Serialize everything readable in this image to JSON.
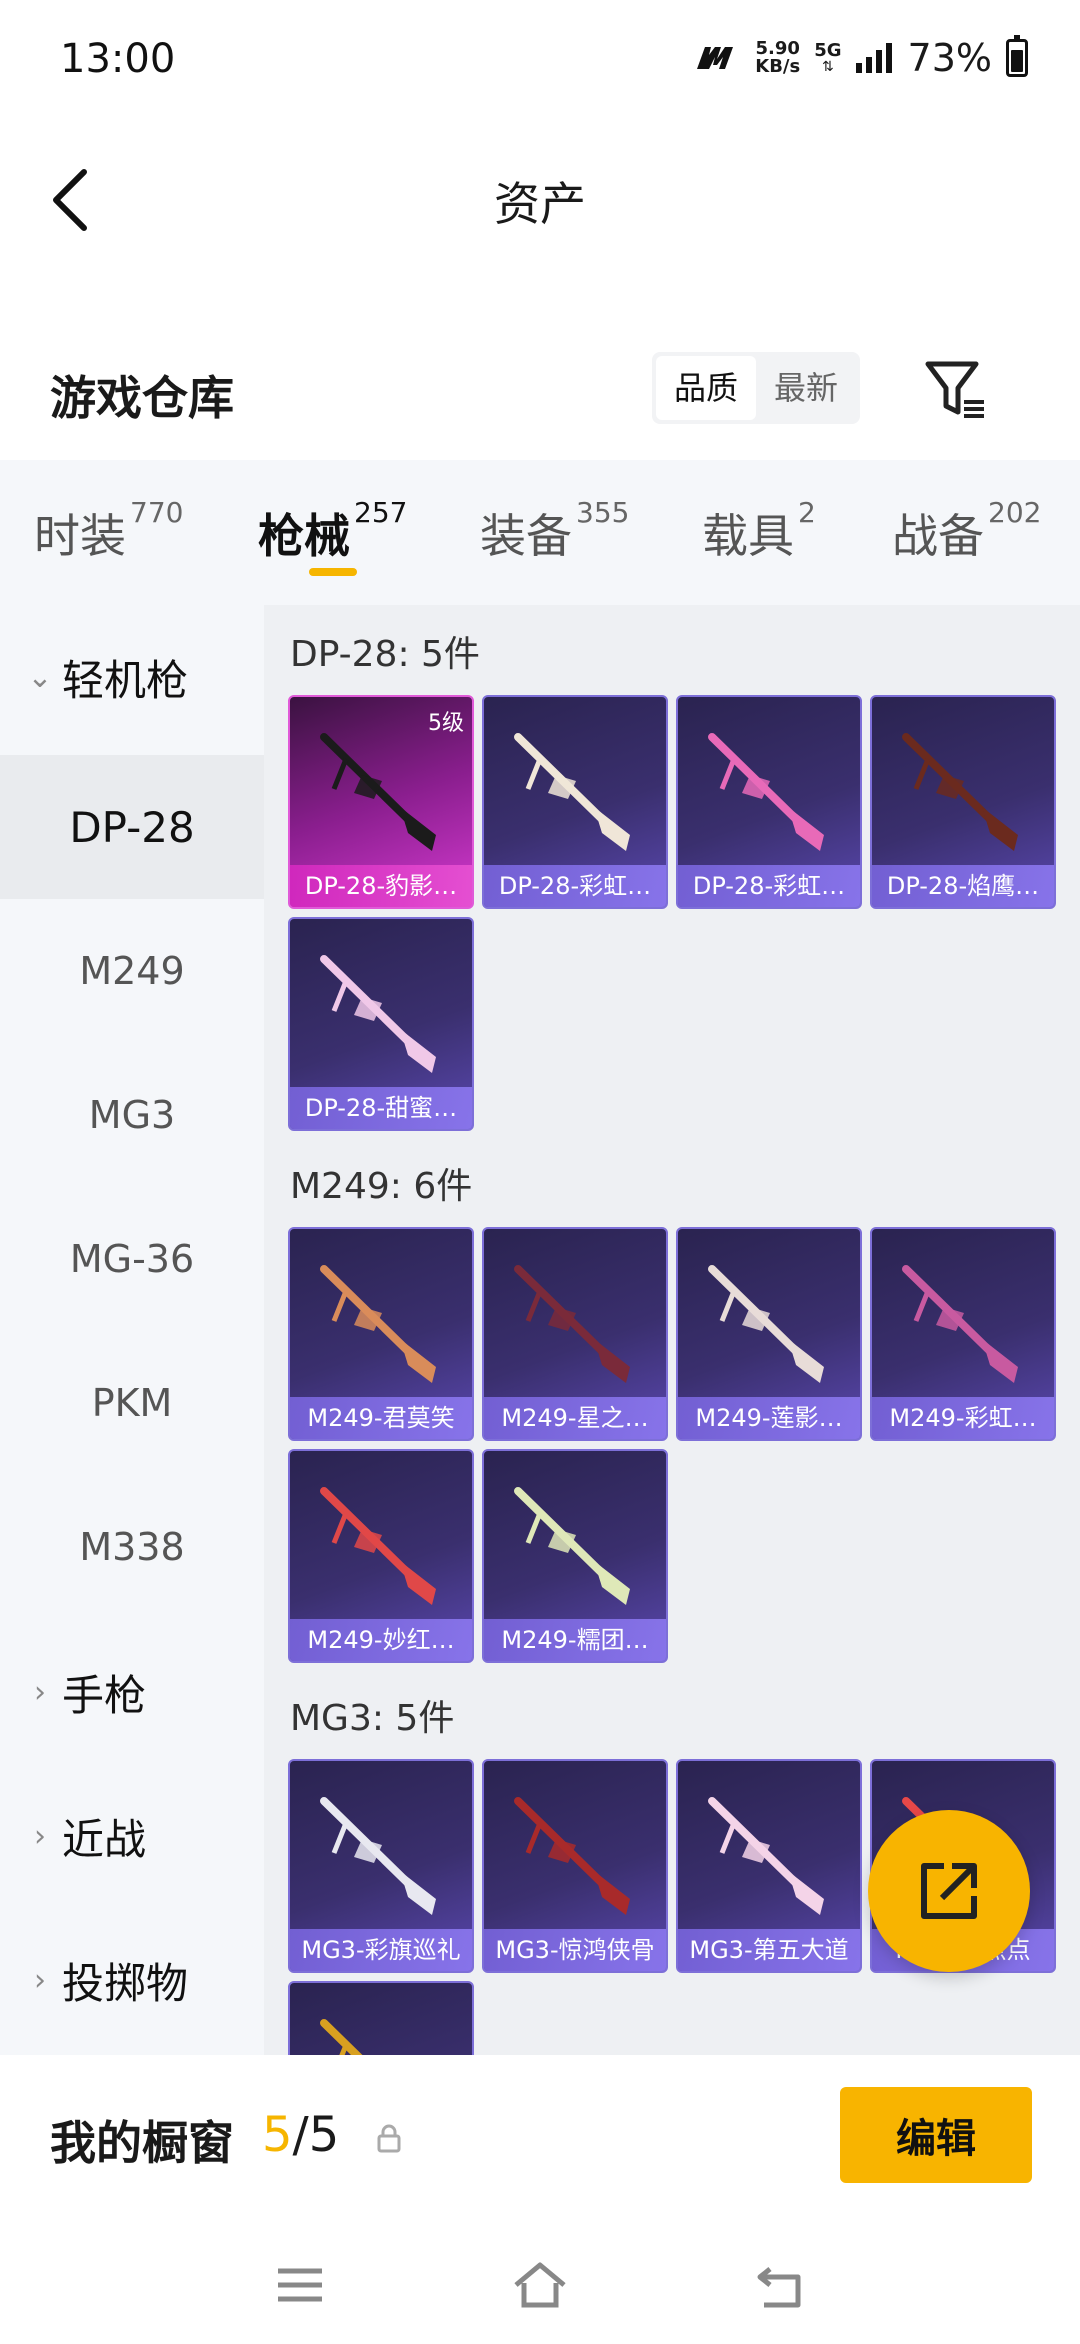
{
  "status": {
    "time": "13:00",
    "net_speed_value": "5.90",
    "net_speed_unit": "KB/s",
    "network": "5G",
    "battery": "73%"
  },
  "header": {
    "title": "资产"
  },
  "warehouse": {
    "title": "游戏仓库",
    "sort_options": [
      "品质",
      "最新"
    ],
    "sort_selected": "品质"
  },
  "tabs": [
    {
      "label": "时装",
      "count": "770"
    },
    {
      "label": "枪械",
      "count": "257"
    },
    {
      "label": "装备",
      "count": "355"
    },
    {
      "label": "载具",
      "count": "2"
    },
    {
      "label": "战备",
      "count": "202"
    }
  ],
  "sidebar": {
    "group_open": "轻机枪",
    "items": [
      "DP-28",
      "M249",
      "MG3",
      "MG-36",
      "PKM",
      "M338"
    ],
    "groups_closed": [
      "手枪",
      "近战",
      "投掷物"
    ]
  },
  "sections": [
    {
      "title": "DP-28: 5件",
      "items": [
        {
          "label": "DP-28-豹影…",
          "level": "5级",
          "rarity": "purple",
          "color": "#1b1b1b"
        },
        {
          "label": "DP-28-彩虹…",
          "rarity": "blue",
          "color": "#f0e6d8"
        },
        {
          "label": "DP-28-彩虹…",
          "rarity": "blue",
          "color": "#e86ab8"
        },
        {
          "label": "DP-28-焰鹰…",
          "rarity": "blue",
          "color": "#6b2a1e"
        },
        {
          "label": "DP-28-甜蜜…",
          "rarity": "blue",
          "color": "#f0c8e8"
        }
      ]
    },
    {
      "title": "M249: 6件",
      "items": [
        {
          "label": "M249-君莫笑",
          "rarity": "blue",
          "color": "#d98c5a"
        },
        {
          "label": "M249-星之…",
          "rarity": "blue",
          "color": "#7a2a3a"
        },
        {
          "label": "M249-莲影…",
          "rarity": "blue",
          "color": "#e8dcd8"
        },
        {
          "label": "M249-彩虹…",
          "rarity": "blue",
          "color": "#c85aa0"
        },
        {
          "label": "M249-妙红…",
          "rarity": "blue",
          "color": "#e04848"
        },
        {
          "label": "M249-糯团…",
          "rarity": "blue",
          "color": "#dfe8b8"
        }
      ]
    },
    {
      "title": "MG3: 5件",
      "items": [
        {
          "label": "MG3-彩旗巡礼",
          "rarity": "blue",
          "color": "#e8e8f0"
        },
        {
          "label": "MG3-惊鸿侠骨",
          "rarity": "blue",
          "color": "#a82a2a"
        },
        {
          "label": "MG3-第五大道",
          "rarity": "blue",
          "color": "#f4d4e8"
        },
        {
          "label": "MG3-…点点",
          "rarity": "blue",
          "color": "#e84848"
        },
        {
          "label": "",
          "rarity": "blue",
          "color": "#d8a020"
        }
      ]
    }
  ],
  "bottom": {
    "showcase_label": "我的橱窗",
    "count_current": "5",
    "count_sep": "/",
    "count_total": "5",
    "edit_label": "编辑"
  },
  "colors": {
    "accent": "#f8b400",
    "card_blue": "#3a2f6e",
    "card_purple": "#c42ec0"
  }
}
